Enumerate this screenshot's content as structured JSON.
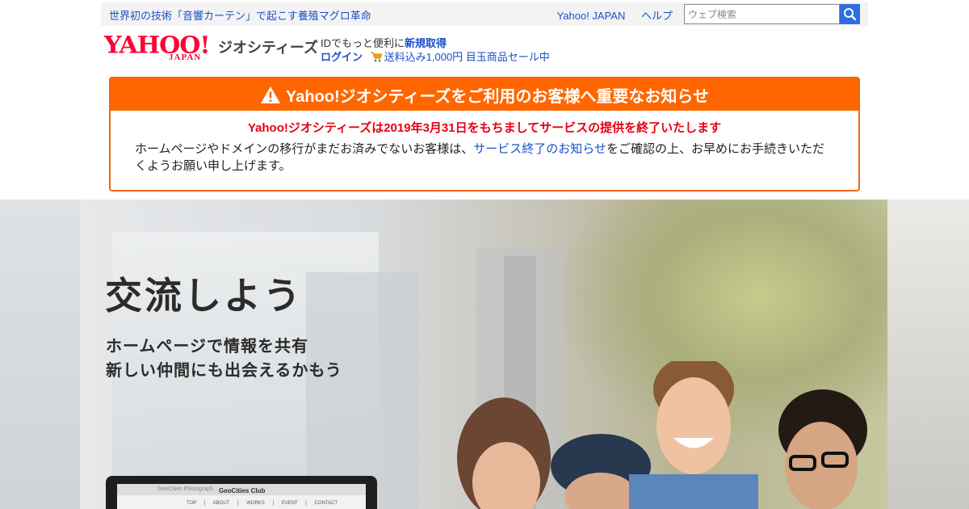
{
  "topbar": {
    "news_link": "世界初の技術「音響カーテン」で起こす養殖マグロ革命",
    "yahoo_japan_link": "Yahoo! JAPAN",
    "help_link": "ヘルプ",
    "search_placeholder": "ウェブ検索"
  },
  "header": {
    "logo_text": "YAHOO!",
    "logo_sub": "JAPAN",
    "service_name": "ジオシティーズ",
    "id_prefix": "IDでもっと便利に",
    "signup_link": "新規取得",
    "login_link": "ログイン",
    "sale_link": "送料込み1,000円 目玉商品セール中"
  },
  "notice": {
    "title": "Yahoo!ジオシティーズをご利用のお客様へ重要なお知らせ",
    "alert": "Yahoo!ジオシティーズは2019年3月31日をもちましてサービスの提供を終了いたします",
    "body_before": "ホームページやドメインの移行がまだお済みでないお客様は、",
    "body_link": "サービス終了のお知らせ",
    "body_after": "をご確認の上、お早めにお手続きいただくようお願い申し上げます。"
  },
  "hero": {
    "title": "交流しよう",
    "line1": "ホームページで情報を共有",
    "line2": "新しい仲間にも出会えるかもう"
  },
  "laptop": {
    "brand": "GeoCities Photograph",
    "club": "GeoCities Club",
    "nav": "TOP | ABOUT | WORKS | EVENT | CONTACT"
  },
  "colors": {
    "accent_orange": "#ff6600",
    "alert_red": "#e60012",
    "link_blue": "#1a50c8",
    "logo_red": "#ff0033"
  }
}
